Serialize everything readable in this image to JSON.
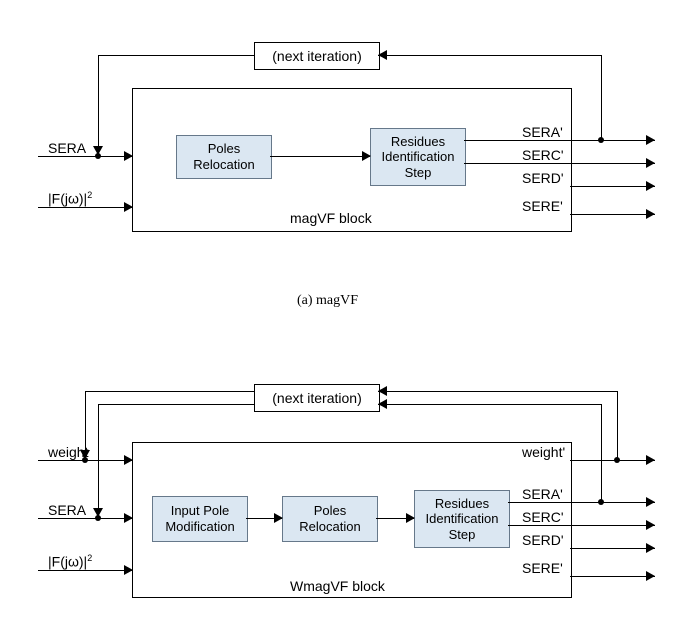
{
  "top": {
    "next_iteration": "(next iteration)",
    "big_block_label": "magVF block",
    "poles_relocation": "Poles\nRelocation",
    "residues_step": "Residues\nIdentification\nStep",
    "input_sera": "SERA",
    "input_f": "|F(jω)|",
    "input_f_exp": "2",
    "out_sera": "SERA'",
    "out_serc": "SERC'",
    "out_serd": "SERD'",
    "out_sere": "SERE'",
    "caption": "(a) magVF"
  },
  "bottom": {
    "next_iteration": "(next iteration)",
    "big_block_label": "WmagVF block",
    "input_pole_mod": "Input Pole\nModification",
    "poles_relocation": "Poles\nRelocation",
    "residues_step": "Residues\nIdentification\nStep",
    "input_weight": "weight",
    "input_sera": "SERA",
    "input_f": "|F(jω)|",
    "input_f_exp": "2",
    "out_weight": "weight'",
    "out_sera": "SERA'",
    "out_serc": "SERC'",
    "out_serd": "SERD'",
    "out_sere": "SERE'"
  }
}
